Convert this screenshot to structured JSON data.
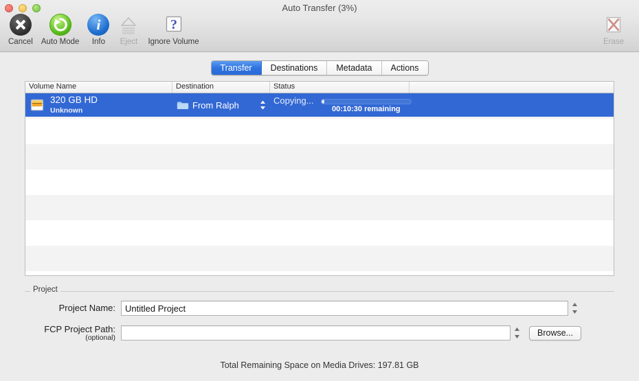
{
  "window": {
    "title": "Auto Transfer (3%)",
    "traffic_lights": [
      "close-button",
      "minimize-button",
      "zoom-button"
    ]
  },
  "toolbar": {
    "items": [
      {
        "label": "Cancel",
        "icon": "cancel-icon",
        "enabled": true
      },
      {
        "label": "Auto Mode",
        "icon": "auto-mode-refresh-icon",
        "enabled": true
      },
      {
        "label": "Info",
        "icon": "info-icon",
        "enabled": true
      },
      {
        "label": "Eject",
        "icon": "eject-icon",
        "enabled": false
      },
      {
        "label": "Ignore Volume",
        "icon": "ignore-volume-question-icon",
        "enabled": true
      }
    ],
    "erase": {
      "label": "Erase",
      "icon": "erase-x-icon",
      "enabled": false
    }
  },
  "tabs": [
    {
      "label": "Transfer",
      "active": true
    },
    {
      "label": "Destinations",
      "active": false
    },
    {
      "label": "Metadata",
      "active": false
    },
    {
      "label": "Actions",
      "active": false
    }
  ],
  "table": {
    "columns": [
      "Volume Name",
      "Destination",
      "Status"
    ],
    "rows": [
      {
        "volume_name": "320 GB HD",
        "volume_subtitle": "Unknown",
        "volume_icon": "hard-drive-icon",
        "destination": "From Ralph",
        "destination_icon": "folder-icon",
        "status": "Copying...",
        "progress_percent": 3,
        "time_remaining": "00:10:30 remaining",
        "selected": true
      }
    ]
  },
  "project": {
    "group_label": "Project",
    "name_label": "Project Name:",
    "name_value": "Untitled Project",
    "name_placeholder": "",
    "path_label": "FCP Project Path:",
    "path_sublabel": "(optional)",
    "path_value": "",
    "path_placeholder": "",
    "browse_label": "Browse..."
  },
  "footer": {
    "status": "Total Remaining Space on Media Drives: 197.81 GB"
  },
  "colors": {
    "selection_blue": "#3268d4",
    "tab_active_blue": "#2f74e0",
    "toolbar_top": "#ededed",
    "toolbar_bottom": "#d2d2d2",
    "stripe_gray": "#f3f3f3"
  }
}
